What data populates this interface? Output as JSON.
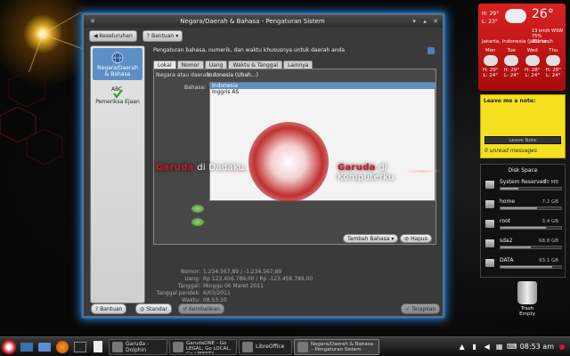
{
  "window": {
    "title": "Negara/Daerah & Bahasa - Pengaturan Sistem",
    "toolbar": {
      "overview": "Keseluruhan",
      "help": "Bantuan"
    },
    "sidebar": [
      {
        "label": "Negara/Daerah & Bahasa",
        "icon": "globe-icon",
        "selected": true
      },
      {
        "label": "Pemeriksa Ejaan",
        "icon": "spellcheck-icon",
        "selected": false
      }
    ],
    "header": "Pengaturan bahasa, numerik, dan waktu khususnya untuk daerah anda",
    "tabs": [
      "Lokal",
      "Nomor",
      "Uang",
      "Waktu & Tanggal",
      "Lainnya"
    ],
    "country_label": "Negara atau daerah:",
    "country_value": "Indonesia (Ubah...)",
    "language_label": "Bahasa:",
    "languages": [
      {
        "name": "Indonesia",
        "selected": true
      },
      {
        "name": "Inggris AS",
        "selected": false
      }
    ],
    "add_language": "Tambah Bahasa",
    "remove": "Hapus",
    "info": [
      {
        "k": "Nomor:",
        "v": "1.234.567,89 / -1.234.567,89"
      },
      {
        "k": "Uang:",
        "v": "Rp 123.456.789,00 / Rp -123.456.789,00"
      },
      {
        "k": "Tanggal:",
        "v": "Minggu 06 Maret 2011"
      },
      {
        "k": "Tanggal pendek:",
        "v": "6/03/2011"
      },
      {
        "k": "Waktu:",
        "v": "08.53.10"
      }
    ],
    "bottom": {
      "help": "Bantuan",
      "default": "Standar",
      "reset": "Kembalikan",
      "apply": "Terapkan"
    },
    "banner_left_1": "Garuda",
    "banner_left_2": " di Dadaku",
    "banner_right_1": "Garuda",
    "banner_right_2": " di Komputerku"
  },
  "weather": {
    "temp": "26°",
    "high": "H: 29°",
    "low": "L: 23°",
    "detail": "13 km/h WSW\n75%\n201 km/h",
    "location": "Jakarta, Indonesia (Jakarta...",
    "forecast": [
      {
        "day": "Mon",
        "hi": "H: 29°",
        "lo": "L: 24°"
      },
      {
        "day": "Tue",
        "hi": "H: 29°",
        "lo": "L: 24°"
      },
      {
        "day": "Wed",
        "hi": "H: 28°",
        "lo": "L: 24°"
      },
      {
        "day": "Thu",
        "hi": "H: 28°",
        "lo": "L: 24°"
      }
    ]
  },
  "note": {
    "title": "Leave me a note:",
    "button": "Leave Note",
    "footer": "0 unread messages"
  },
  "disk": {
    "title": "Disk Space",
    "drives": [
      {
        "name": "System Reserved",
        "size": "70 MB",
        "used": 0.3
      },
      {
        "name": "home",
        "size": "7.2 GB",
        "used": 0.6
      },
      {
        "name": "root",
        "size": "3.4 GB",
        "used": 0.75
      },
      {
        "name": "sda2",
        "size": "68.8 GB",
        "used": 0.5
      },
      {
        "name": "DATA",
        "size": "93.1 GB",
        "used": 0.85
      }
    ]
  },
  "trash": {
    "line1": "Trash",
    "line2": "Empty"
  },
  "taskbar": {
    "tasks": [
      {
        "label": "Garuda - Dolphin",
        "active": false
      },
      {
        "label": "GarudaONE - Go LEGAL, Go LOCAL, Go LIBERTY",
        "active": false
      },
      {
        "label": "LibreOffice",
        "active": false
      },
      {
        "label": "Negara/Daerah & Bahasa – Pengaturan Sistem",
        "active": true
      }
    ],
    "clock": "08:53 am"
  }
}
